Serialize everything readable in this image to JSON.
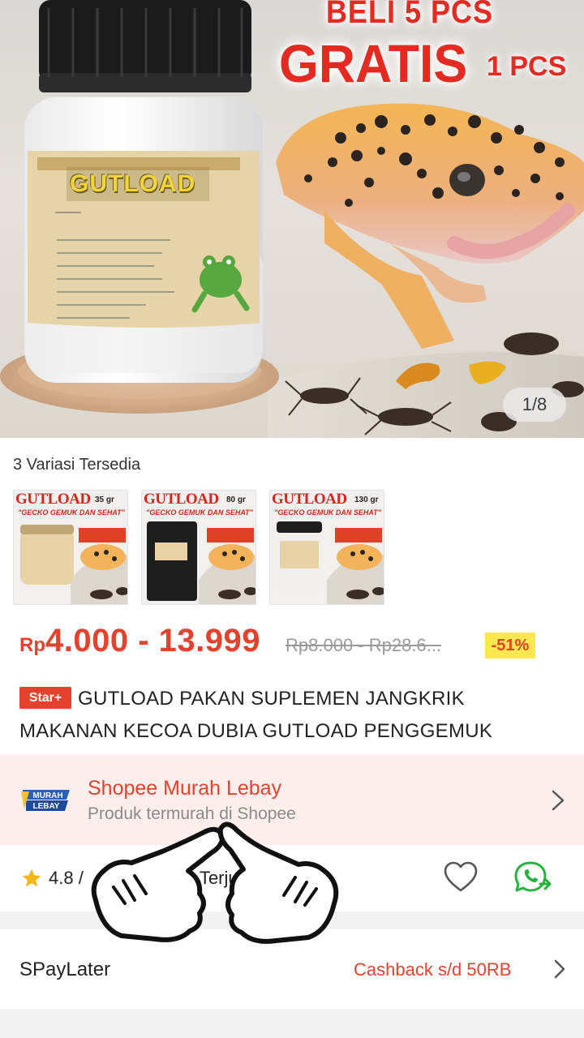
{
  "hero": {
    "promo_line1": "BELI 5 PCS",
    "promo_main": "GRATIS",
    "promo_sub": "1 PCS",
    "jar_label": "GUTLOAD",
    "image_counter": "1/8"
  },
  "variants": {
    "label": "3 Variasi Tersedia",
    "items": [
      {
        "brand": "GUTLOAD",
        "size": "35 gr",
        "tag": "\"GECKO GEMUK DAN SEHAT\""
      },
      {
        "brand": "GUTLOAD",
        "size": "80 gr",
        "tag": "\"GECKO GEMUK DAN SEHAT\""
      },
      {
        "brand": "GUTLOAD",
        "size": "130 gr",
        "tag": "\"GECKO GEMUK DAN SEHAT\""
      }
    ]
  },
  "price": {
    "currency": "Rp",
    "range": "4.000 - 13.999",
    "original": "Rp8.000 - Rp28.6...",
    "discount": "-51%"
  },
  "product": {
    "badge": "Star+",
    "title_line1": "GUTLOAD PAKAN SUPLEMEN JANGKRIK",
    "title_line2": "MAKANAN KECOA DUBIA GUTLOAD PENGGEMUK"
  },
  "shop": {
    "logo_text_top": "MURAH",
    "logo_text_bottom": "LEBAY",
    "name": "Shopee Murah Lebay",
    "subtitle": "Produk termurah di Shopee"
  },
  "rating": {
    "value": "4.8 /",
    "sold_fragment": "3 Terju"
  },
  "paylater": {
    "label": "SPayLater",
    "cashback": "Cashback s/d 50RB"
  },
  "colors": {
    "accent": "#e4422d",
    "discount_bg": "#fde74f",
    "shop_banner_bg": "#fdeeee",
    "whatsapp": "#25b33d"
  }
}
